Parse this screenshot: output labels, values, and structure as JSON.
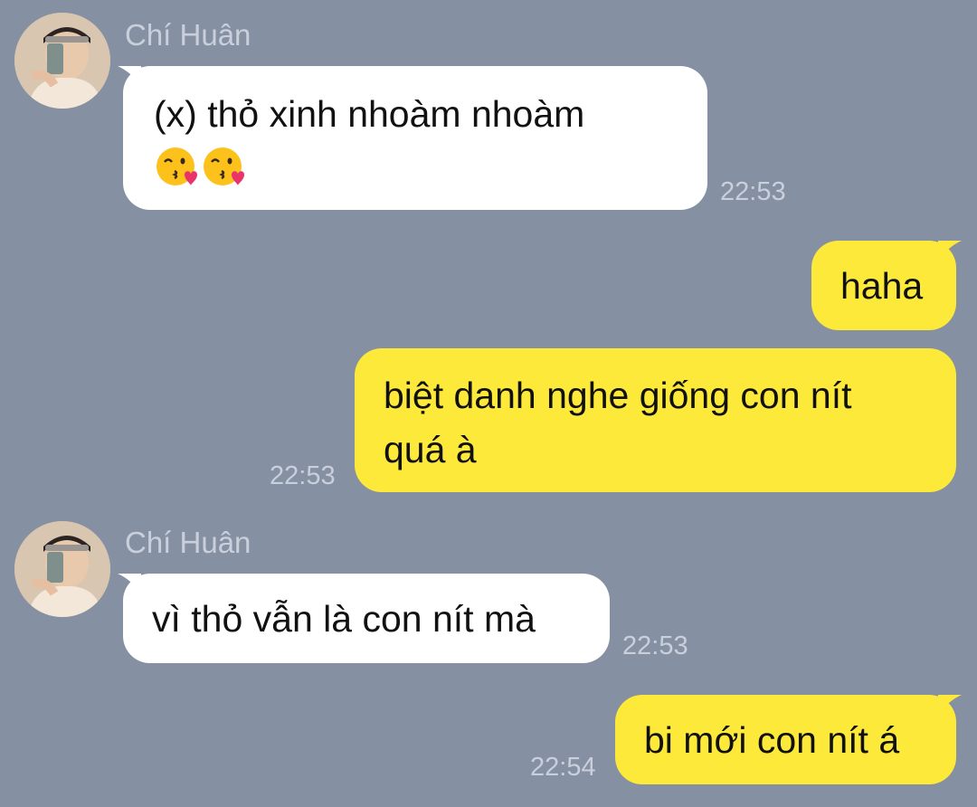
{
  "messages": [
    {
      "direction": "incoming",
      "sender": "Chí Huân",
      "text": "(x) thỏ xinh nhoàm nhoàm",
      "emoji": [
        "kissing-face-with-heart-emoji",
        "kissing-face-with-heart-emoji"
      ],
      "time": "22:53"
    },
    {
      "direction": "outgoing",
      "text": "haha"
    },
    {
      "direction": "outgoing",
      "text_line1": "biệt danh nghe giống con nít",
      "text_line2": "quá à",
      "time": "22:53"
    },
    {
      "direction": "incoming",
      "sender": "Chí Huân",
      "text": "vì thỏ vẫn là con nít mà",
      "time": "22:53"
    },
    {
      "direction": "outgoing",
      "text": "bi mới con nít á",
      "time": "22:54"
    }
  ],
  "colors": {
    "background": "#8690a3",
    "incoming_bubble": "#ffffff",
    "outgoing_bubble": "#fde93a",
    "meta_text": "#c9cfdb"
  }
}
